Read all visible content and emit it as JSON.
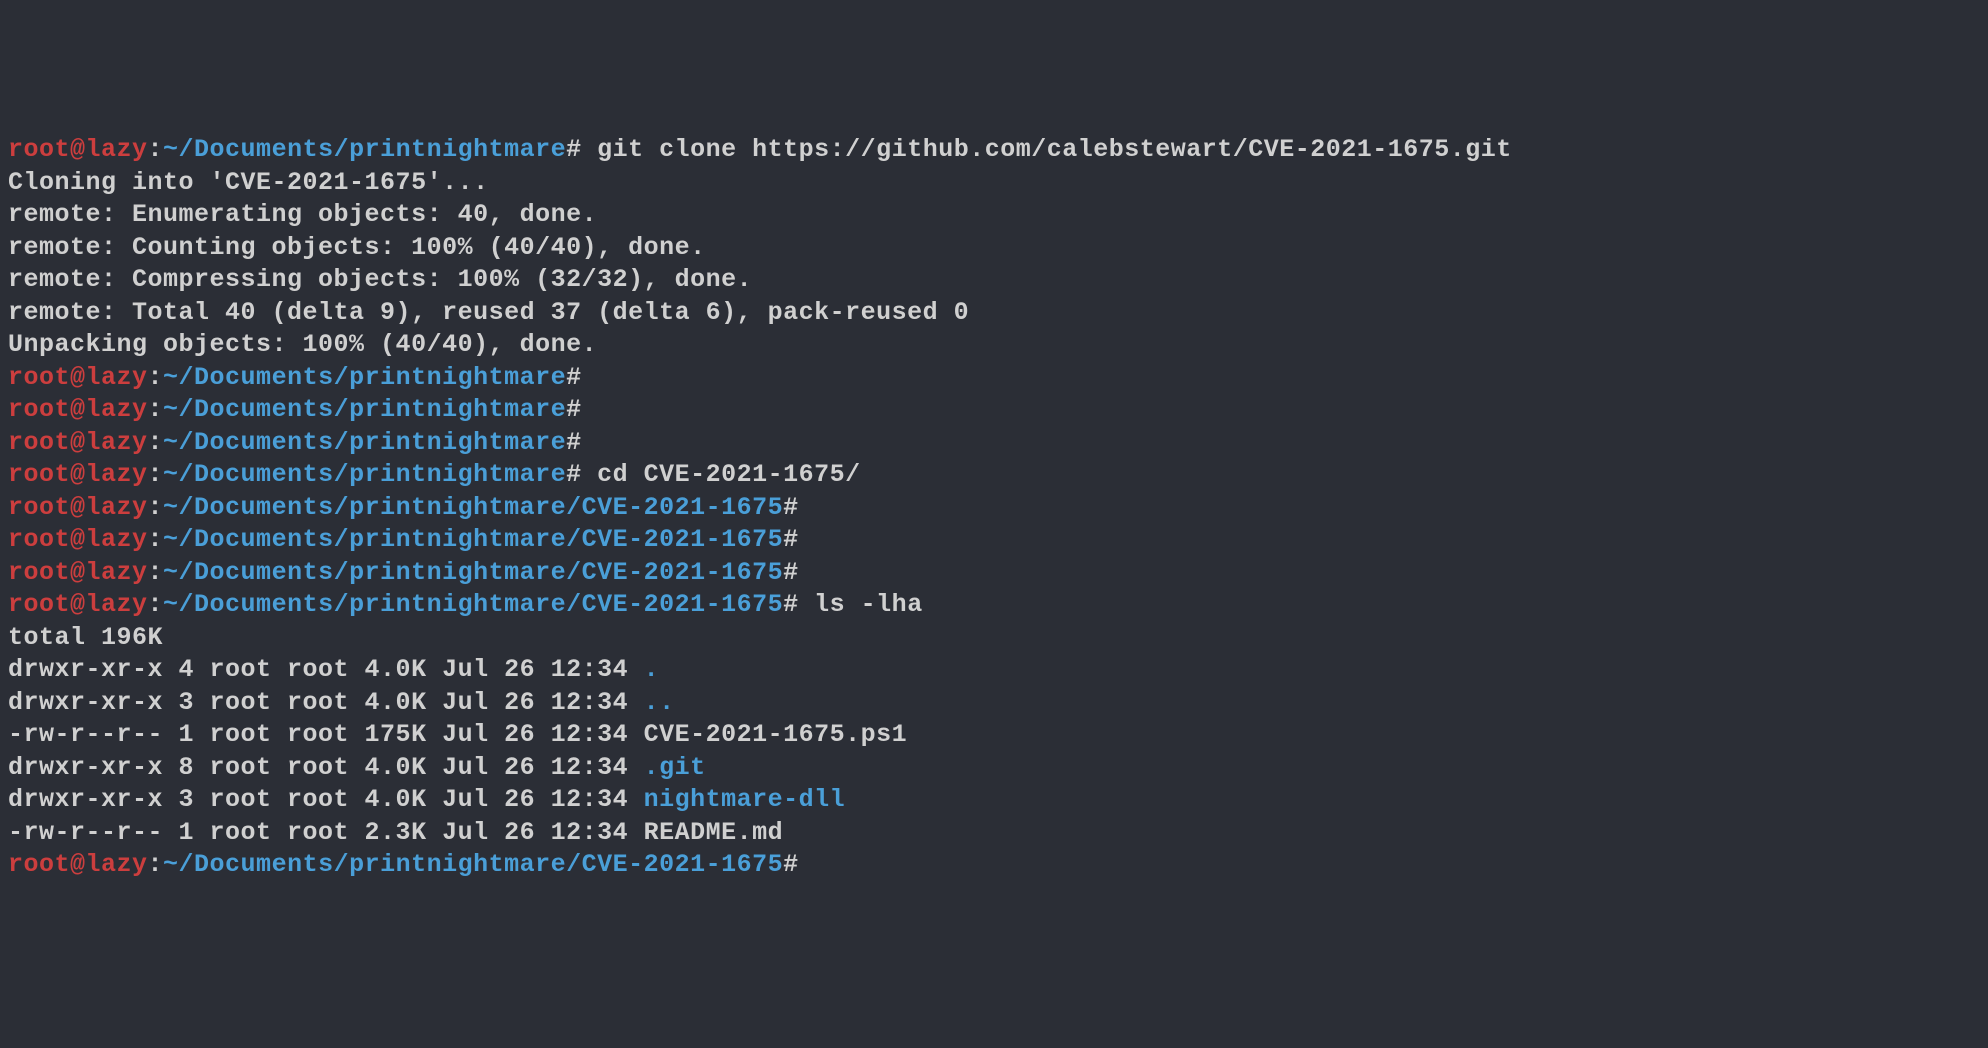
{
  "prompt": {
    "user_host": "root@lazy",
    "sep1": ":",
    "path1": "~/Documents/printnightmare",
    "path2": "~/Documents/printnightmare/CVE-2021-1675",
    "hash": "#"
  },
  "lines": [
    {
      "type": "prompt",
      "path": "path1",
      "cmd": " git clone https://github.com/calebstewart/CVE-2021-1675.git"
    },
    {
      "type": "output",
      "text": "Cloning into 'CVE-2021-1675'..."
    },
    {
      "type": "output",
      "text": "remote: Enumerating objects: 40, done."
    },
    {
      "type": "output",
      "text": "remote: Counting objects: 100% (40/40), done."
    },
    {
      "type": "output",
      "text": "remote: Compressing objects: 100% (32/32), done."
    },
    {
      "type": "output",
      "text": "remote: Total 40 (delta 9), reused 37 (delta 6), pack-reused 0"
    },
    {
      "type": "output",
      "text": "Unpacking objects: 100% (40/40), done."
    },
    {
      "type": "prompt",
      "path": "path1",
      "cmd": ""
    },
    {
      "type": "prompt",
      "path": "path1",
      "cmd": ""
    },
    {
      "type": "prompt",
      "path": "path1",
      "cmd": ""
    },
    {
      "type": "prompt",
      "path": "path1",
      "cmd": " cd CVE-2021-1675/"
    },
    {
      "type": "prompt",
      "path": "path2",
      "cmd": ""
    },
    {
      "type": "prompt",
      "path": "path2",
      "cmd": ""
    },
    {
      "type": "prompt",
      "path": "path2",
      "cmd": ""
    },
    {
      "type": "prompt",
      "path": "path2",
      "cmd": " ls -lha"
    },
    {
      "type": "output",
      "text": "total 196K"
    },
    {
      "type": "ls",
      "perm": "drwxr-xr-x 4 root root 4.0K Jul 26 12:34 ",
      "name": ".",
      "isdir": true
    },
    {
      "type": "ls",
      "perm": "drwxr-xr-x 3 root root 4.0K Jul 26 12:34 ",
      "name": "..",
      "isdir": true
    },
    {
      "type": "ls",
      "perm": "-rw-r--r-- 1 root root 175K Jul 26 12:34 ",
      "name": "CVE-2021-1675.ps1",
      "isdir": false
    },
    {
      "type": "ls",
      "perm": "drwxr-xr-x 8 root root 4.0K Jul 26 12:34 ",
      "name": ".git",
      "isdir": true
    },
    {
      "type": "ls",
      "perm": "drwxr-xr-x 3 root root 4.0K Jul 26 12:34 ",
      "name": "nightmare-dll",
      "isdir": true
    },
    {
      "type": "ls",
      "perm": "-rw-r--r-- 1 root root 2.3K Jul 26 12:34 ",
      "name": "README.md",
      "isdir": false
    },
    {
      "type": "prompt",
      "path": "path2",
      "cmd": ""
    }
  ]
}
